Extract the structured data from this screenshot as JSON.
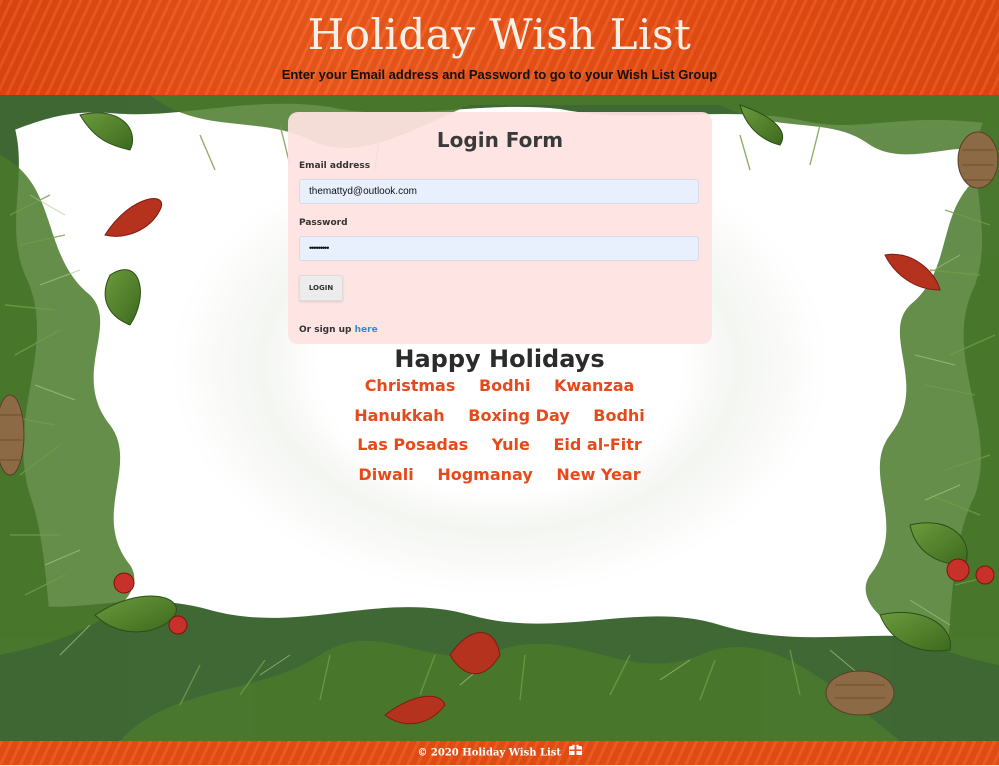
{
  "header": {
    "title": "Holiday Wish List",
    "subtitle": "Enter your Email address and Password to go to your Wish List Group"
  },
  "login": {
    "title": "Login Form",
    "email_label": "Email address",
    "email_value": "themattyd@outlook.com",
    "password_label": "Password",
    "password_value": "•••••••••",
    "button_label": "LOGIN",
    "signup_prefix": "Or sign up",
    "signup_link": "here"
  },
  "holidays": {
    "title": "Happy Holidays",
    "rows": [
      [
        "Christmas",
        "Bodhi",
        "Kwanzaa"
      ],
      [
        "Hanukkah",
        "Boxing Day",
        "Bodhi"
      ],
      [
        "Las Posadas",
        "Yule",
        "Eid al-Fitr"
      ],
      [
        "Diwali",
        "Hogmanay",
        "New Year"
      ]
    ]
  },
  "footer": {
    "text": "© 2020 Holiday Wish List",
    "icon": "gift-icon"
  },
  "colors": {
    "header_orange": "#ea4f14",
    "holiday_text": "#e8491b",
    "form_background": "#ffe2e2",
    "link_blue": "#2b8fd6"
  }
}
